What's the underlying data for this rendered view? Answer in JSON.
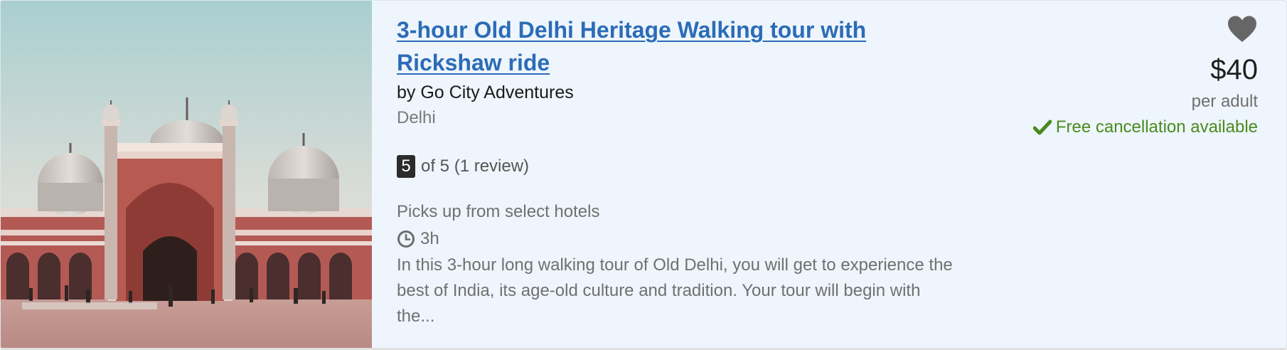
{
  "listing": {
    "title": "3-hour Old Delhi Heritage Walking tour with Rickshaw ride",
    "operator": "by Go City Adventures",
    "location": "Delhi",
    "rating": {
      "score": "5",
      "text": "of 5 (1 review)"
    },
    "pickup": "Picks up from select hotels",
    "duration": "3h",
    "description": "In this 3-hour long walking tour of Old Delhi, you will get to experience the best of India, its age-old culture and tradition. Your tour will begin with the...",
    "price": "$40",
    "price_unit": "per adult",
    "cancellation": "Free cancellation available",
    "image_subject": "Jama Masjid mosque, Delhi",
    "icons": [
      "heart-icon",
      "star-rating-badge",
      "clock-icon",
      "checkmark-icon"
    ]
  },
  "colors": {
    "card_bg": "#eef5fc",
    "title_link": "#2b6cb8",
    "cancellation_green": "#4a8a1d",
    "score_badge": "#2b2b2b",
    "heart": "#666666"
  }
}
